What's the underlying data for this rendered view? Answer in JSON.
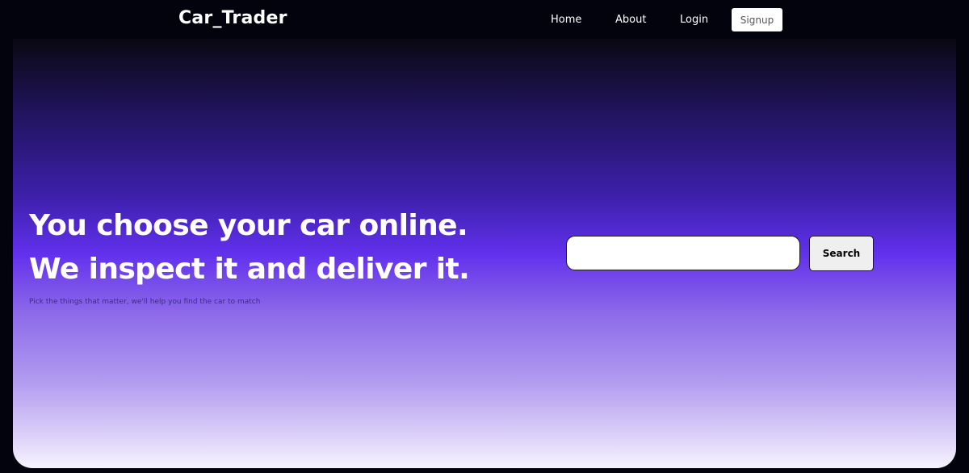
{
  "nav": {
    "brand": "Car_Trader",
    "links": [
      "Home",
      "About",
      "Login"
    ],
    "signup_label": "Signup"
  },
  "hero": {
    "headline_line1": "You choose your car online.",
    "headline_line2": "We inspect it and deliver it.",
    "subtext": "Pick the things that matter, we'll help you find the car to match",
    "search": {
      "value": "",
      "placeholder": "",
      "button_label": "Search"
    }
  },
  "colors": {
    "background": "#03030e",
    "accent": "#6130ec",
    "text": "#ffffff"
  }
}
